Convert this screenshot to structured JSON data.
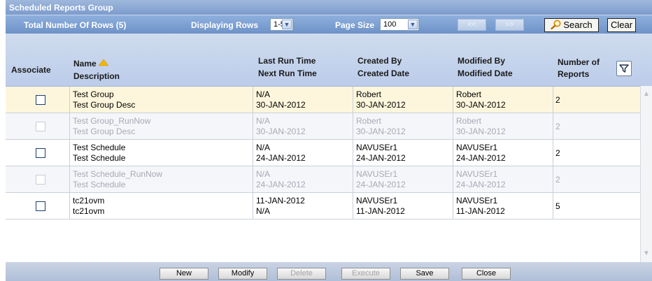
{
  "window": {
    "title": "Scheduled Reports Group"
  },
  "toolbar": {
    "total_rows_label": "Total Number Of Rows (5)",
    "displaying_rows_label": "Displaying Rows",
    "displaying_rows_value": "1-5",
    "page_size_label": "Page Size",
    "page_size_value": "100",
    "prev_label": "<<",
    "next_label": ">>",
    "search_label": "Search",
    "clear_label": "Clear"
  },
  "columns": {
    "associate": "Associate",
    "name": "Name",
    "description": "Description",
    "last_run": "Last Run Time",
    "next_run": "Next Run Time",
    "created_by": "Created By",
    "created_date": "Created Date",
    "modified_by": "Modified By",
    "modified_date": "Modified Date",
    "num_reports_1": "Number of",
    "num_reports_2": "Reports"
  },
  "rows": [
    {
      "name": "Test Group",
      "desc": "Test Group Desc",
      "last_run": "N/A",
      "next_run": "30-JAN-2012",
      "created_by": "Robert",
      "created_date": "30-JAN-2012",
      "modified_by": "Robert",
      "modified_date": "30-JAN-2012",
      "count": "2"
    },
    {
      "name": "Test Group_RunNow",
      "desc": "Test Group Desc",
      "last_run": "N/A",
      "next_run": "30-JAN-2012",
      "created_by": "Robert",
      "created_date": "30-JAN-2012",
      "modified_by": "Robert",
      "modified_date": "30-JAN-2012",
      "count": "2"
    },
    {
      "name": "Test Schedule",
      "desc": "Test Schedule",
      "last_run": "N/A",
      "next_run": "24-JAN-2012",
      "created_by": "NAVUSEr1",
      "created_date": "24-JAN-2012",
      "modified_by": "NAVUSEr1",
      "modified_date": "24-JAN-2012",
      "count": "2"
    },
    {
      "name": "Test Schedule_RunNow",
      "desc": "Test Schedule",
      "last_run": "N/A",
      "next_run": "24-JAN-2012",
      "created_by": "NAVUSEr1",
      "created_date": "24-JAN-2012",
      "modified_by": "NAVUSEr1",
      "modified_date": "24-JAN-2012",
      "count": "2"
    },
    {
      "name": "tc21ovm",
      "desc": "tc21ovm",
      "last_run": "11-JAN-2012",
      "next_run": "N/A",
      "created_by": "NAVUSEr1",
      "created_date": "11-JAN-2012",
      "modified_by": "NAVUSEr1",
      "modified_date": "11-JAN-2012",
      "count": "5"
    }
  ],
  "actions": {
    "new": "New",
    "modify": "Modify",
    "delete": "Delete",
    "execute": "Execute",
    "save": "Save",
    "close": "Close"
  },
  "colors": {
    "title_bar": "#7d9bcd",
    "highlight_row": "#fdf6dc",
    "sort_arrow": "#f2b400"
  },
  "icons": [
    "search-icon",
    "filter-icon",
    "sort-ascending-icon",
    "checkbox-icon"
  ]
}
